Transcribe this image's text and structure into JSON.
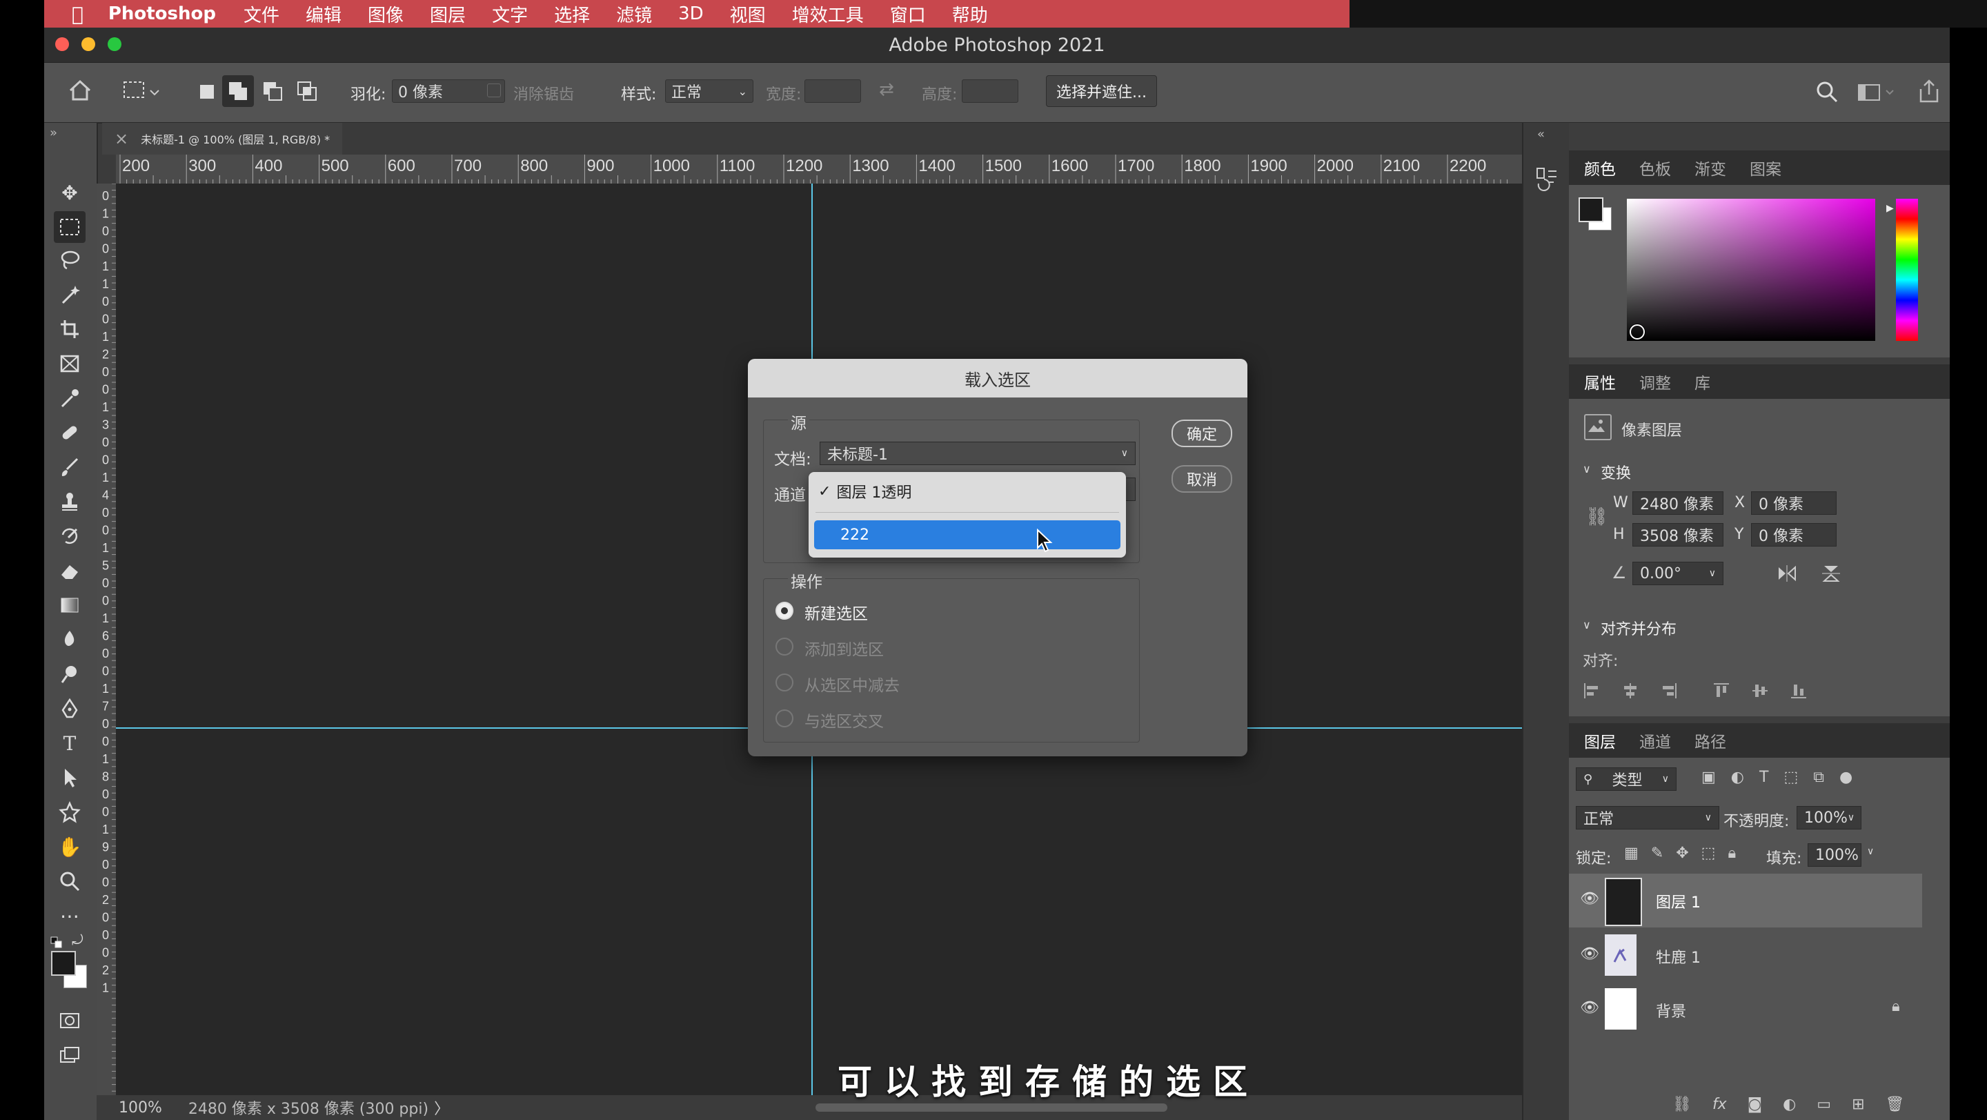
{
  "menubar": {
    "apple": "",
    "app": "Photoshop",
    "items": [
      "文件",
      "编辑",
      "图像",
      "图层",
      "文字",
      "选择",
      "滤镜",
      "3D",
      "视图",
      "增效工具",
      "窗口",
      "帮助"
    ]
  },
  "window": {
    "title": "Adobe Photoshop 2021"
  },
  "options": {
    "feather_label": "羽化:",
    "feather_value": "0 像素",
    "antialias_label": "消除锯齿",
    "style_label": "样式:",
    "style_value": "正常",
    "width_label": "宽度:",
    "height_label": "高度:",
    "select_mask_label": "选择并遮住..."
  },
  "tab": {
    "close": "×",
    "label": "未标题-1 @ 100% (图层 1, RGB/8) *"
  },
  "ruler": {
    "h_ticks": [
      "200",
      "300",
      "400",
      "500",
      "600",
      "700",
      "800",
      "900",
      "1000",
      "1100",
      "1200",
      "1300",
      "1400",
      "1500",
      "1600",
      "1700",
      "1800",
      "1900",
      "2000",
      "2100",
      "2200"
    ],
    "v_ticks": [
      "0",
      "1",
      "0",
      "0",
      "1",
      "1",
      "0",
      "0",
      "1",
      "2",
      "0",
      "0",
      "1",
      "3",
      "0",
      "0",
      "1",
      "4",
      "0",
      "0",
      "1",
      "5",
      "0",
      "0",
      "1",
      "6",
      "0",
      "0",
      "1",
      "7",
      "0",
      "0",
      "1",
      "8",
      "0",
      "0",
      "1",
      "9",
      "0",
      "0",
      "2",
      "0",
      "0",
      "0",
      "2",
      "1"
    ]
  },
  "status": {
    "zoom": "100%",
    "info": "2480 像素 x 3508 像素 (300 ppi)",
    "arrow": "〉"
  },
  "dialog": {
    "title": "载入选区",
    "source_label": "源",
    "doc_label": "文档:",
    "doc_value": "未标题-1",
    "channel_label": "通道",
    "ok": "确定",
    "cancel": "取消",
    "op_label": "操作",
    "op_new": "新建选区",
    "op_add": "添加到选区",
    "op_sub": "从选区中减去",
    "op_intersect": "与选区交叉"
  },
  "popup": {
    "check": "✓",
    "item1": "图层 1透明",
    "item2": "222"
  },
  "subtitle": "可以找到存储的选区",
  "color_panel": {
    "tabs": [
      "颜色",
      "色板",
      "渐变",
      "图案"
    ]
  },
  "props_panel": {
    "tabs": [
      "属性",
      "调整",
      "库"
    ],
    "layer_type": "像素图层",
    "transform": "变换",
    "w_label": "W",
    "w_value": "2480 像素",
    "x_label": "X",
    "x_value": "0 像素",
    "h_label": "H",
    "h_value": "3508 像素",
    "y_label": "Y",
    "y_value": "0 像素",
    "angle": "0.00°",
    "align_section": "对齐并分布",
    "align_label": "对齐:"
  },
  "layers_panel": {
    "tabs": [
      "图层",
      "通道",
      "路径"
    ],
    "filter": "类型",
    "blend": "正常",
    "opacity_label": "不透明度:",
    "opacity": "100%",
    "lock_label": "锁定:",
    "fill_label": "填充:",
    "fill": "100%",
    "layers": [
      {
        "name": "图层 1"
      },
      {
        "name": "牡鹿 1"
      },
      {
        "name": "背景"
      }
    ]
  },
  "colors": {
    "menubar": "#c8474d",
    "selection": "#2a7fe0",
    "guide": "#5cc8e8"
  }
}
